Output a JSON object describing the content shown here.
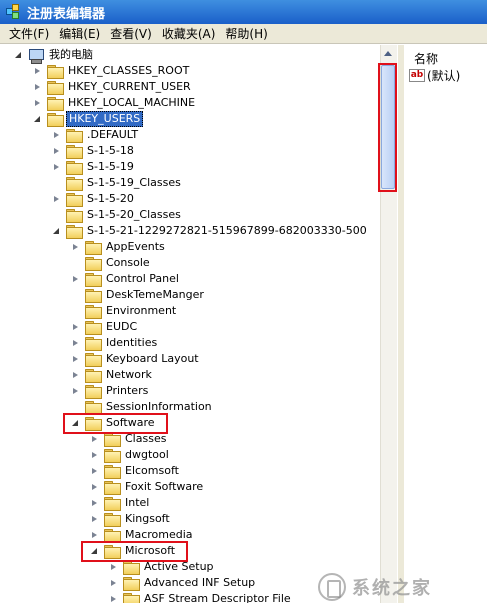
{
  "window": {
    "title": "注册表编辑器"
  },
  "menu": [
    "文件(F)",
    "编辑(E)",
    "查看(V)",
    "收藏夹(A)",
    "帮助(H)"
  ],
  "right_pane": {
    "column_header": "名称",
    "values": [
      {
        "icon": "string-value-icon",
        "name": "(默认)"
      }
    ]
  },
  "tree": [
    {
      "label": "我的电脑",
      "icon": "computer-icon",
      "state": "expanded"
    },
    {
      "label": "HKEY_CLASSES_ROOT",
      "state": "collapsed"
    },
    {
      "label": "HKEY_CURRENT_USER",
      "state": "collapsed"
    },
    {
      "label": "HKEY_LOCAL_MACHINE",
      "state": "collapsed"
    },
    {
      "label": "HKEY_USERS",
      "state": "expanded",
      "selected": true
    },
    {
      "label": ".DEFAULT",
      "state": "collapsed"
    },
    {
      "label": "S-1-5-18",
      "state": "collapsed"
    },
    {
      "label": "S-1-5-19",
      "state": "collapsed"
    },
    {
      "label": "S-1-5-19_Classes",
      "state": "none"
    },
    {
      "label": "S-1-5-20",
      "state": "collapsed"
    },
    {
      "label": "S-1-5-20_Classes",
      "state": "none"
    },
    {
      "label": "S-1-5-21-1229272821-515967899-682003330-500",
      "state": "expanded"
    },
    {
      "label": "AppEvents",
      "state": "collapsed"
    },
    {
      "label": "Console",
      "state": "none"
    },
    {
      "label": "Control Panel",
      "state": "collapsed"
    },
    {
      "label": "DeskTemeManger",
      "state": "none"
    },
    {
      "label": "Environment",
      "state": "none"
    },
    {
      "label": "EUDC",
      "state": "collapsed"
    },
    {
      "label": "Identities",
      "state": "collapsed"
    },
    {
      "label": "Keyboard Layout",
      "state": "collapsed"
    },
    {
      "label": "Network",
      "state": "collapsed"
    },
    {
      "label": "Printers",
      "state": "collapsed"
    },
    {
      "label": "SessionInformation",
      "state": "none"
    },
    {
      "label": "Software",
      "state": "expanded"
    },
    {
      "label": "Classes",
      "state": "collapsed"
    },
    {
      "label": "dwgtool",
      "state": "collapsed"
    },
    {
      "label": "Elcomsoft",
      "state": "collapsed"
    },
    {
      "label": "Foxit Software",
      "state": "collapsed"
    },
    {
      "label": "Intel",
      "state": "collapsed"
    },
    {
      "label": "Kingsoft",
      "state": "collapsed"
    },
    {
      "label": "Macromedia",
      "state": "collapsed"
    },
    {
      "label": "Microsoft",
      "state": "expanded"
    },
    {
      "label": "Active Setup",
      "state": "collapsed"
    },
    {
      "label": "Advanced INF Setup",
      "state": "collapsed"
    },
    {
      "label": "ASF Stream Descriptor File",
      "state": "collapsed"
    }
  ],
  "watermark": "系统之家"
}
